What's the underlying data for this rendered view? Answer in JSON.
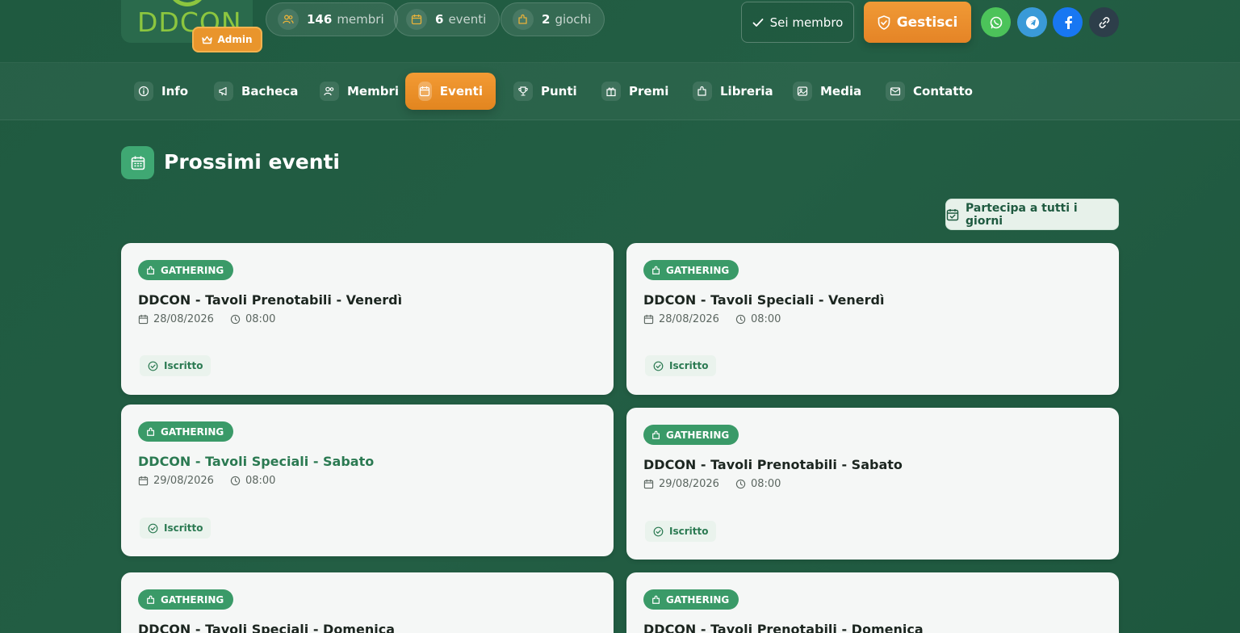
{
  "header": {
    "logo_text": "DDCON",
    "admin_label": "Admin",
    "stats": [
      {
        "num": "146",
        "label": "membri",
        "icon": "users-icon"
      },
      {
        "num": "6",
        "label": "eventi",
        "icon": "calendar-icon"
      },
      {
        "num": "2",
        "label": "giochi",
        "icon": "puzzle-icon"
      }
    ],
    "member_label": "Sei membro",
    "manage_label": "Gestisci",
    "social": [
      {
        "name": "whatsapp-icon",
        "color": "#4cc35a"
      },
      {
        "name": "telegram-icon",
        "color": "#3a9ad8"
      },
      {
        "name": "facebook-icon",
        "color": "#1877f2"
      },
      {
        "name": "link-icon",
        "color": "#2d3e4a"
      }
    ]
  },
  "nav": {
    "items": [
      {
        "label": "Info"
      },
      {
        "label": "Bacheca"
      },
      {
        "label": "Membri"
      },
      {
        "label": "Eventi",
        "active": true
      },
      {
        "label": "Punti"
      },
      {
        "label": "Premi"
      },
      {
        "label": "Libreria"
      },
      {
        "label": "Media"
      },
      {
        "label": "Contatto"
      }
    ]
  },
  "section": {
    "title": "Prossimi eventi",
    "join_all_label": "Partecipa a tutti i giorni"
  },
  "events": [
    {
      "tag": "GATHERING",
      "title": "DDCON - Tavoli Prenotabili - Venerdì",
      "date": "28/08/2026",
      "time": "08:00",
      "status": "Iscritto"
    },
    {
      "tag": "GATHERING",
      "title": "DDCON - Tavoli Speciali - Venerdì",
      "date": "28/08/2026",
      "time": "08:00",
      "status": "Iscritto"
    },
    {
      "tag": "GATHERING",
      "title": "DDCON - Tavoli Speciali - Sabato",
      "date": "29/08/2026",
      "time": "08:00",
      "status": "Iscritto"
    },
    {
      "tag": "GATHERING",
      "title": "DDCON - Tavoli Prenotabili - Sabato",
      "date": "29/08/2026",
      "time": "08:00",
      "status": "Iscritto"
    },
    {
      "tag": "GATHERING",
      "title": "DDCON - Tavoli Speciali - Domenica",
      "date": "",
      "time": "",
      "status": ""
    },
    {
      "tag": "GATHERING",
      "title": "DDCON - Tavoli Prenotabili - Domenica",
      "date": "",
      "time": "",
      "status": ""
    }
  ],
  "colors": {
    "background": "#235e44",
    "accent_orange": "#e9952c",
    "tag_green": "#3a9a68"
  }
}
